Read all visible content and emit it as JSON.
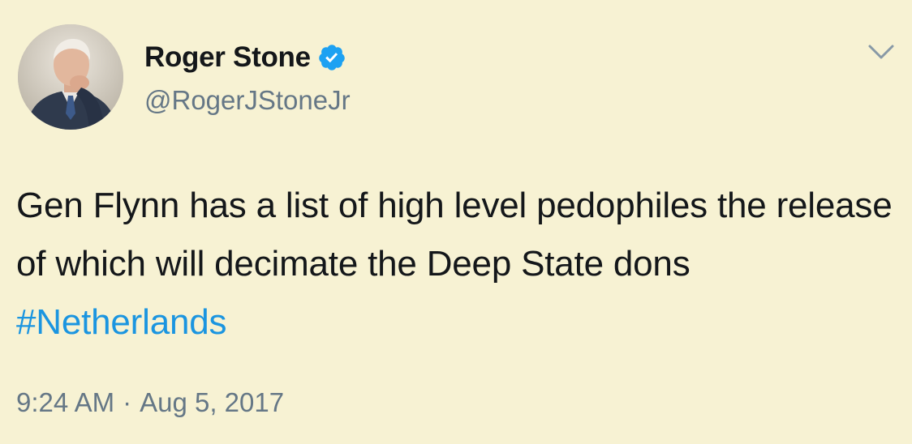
{
  "tweet": {
    "author": {
      "display_name": "Roger Stone",
      "handle": "@RogerJStoneJr",
      "verified": true,
      "avatar_icon": "profile-photo"
    },
    "text": {
      "main": "Gen Flynn has a list of high level pedophiles the release of which will decimate the Deep State dons",
      "hashtag": "#Netherlands"
    },
    "time": "9:24 AM",
    "separator": "·",
    "date": "Aug 5, 2017",
    "menu_icon": "chevron-down-icon",
    "colors": {
      "background": "#f7f2d3",
      "link": "#1b95e0",
      "verified_badge": "#1da1f2",
      "secondary_text": "#657786"
    }
  }
}
